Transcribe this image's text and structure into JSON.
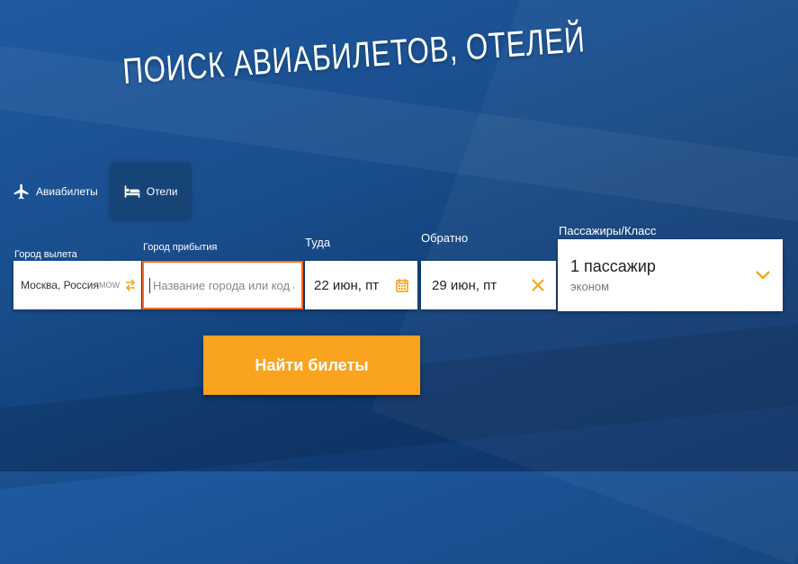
{
  "hero": {
    "title": "ПОИСК АВИАБИЛЕТОВ, ОТЕЛЕЙ"
  },
  "tabs": [
    {
      "label": "Авиабилеты",
      "icon": "airplane-icon",
      "active": false
    },
    {
      "label": "Отели",
      "icon": "bed-icon",
      "active": true
    }
  ],
  "form": {
    "from": {
      "label": "Город вылета",
      "value": "Москва, Россия",
      "code": "MOW"
    },
    "to": {
      "label": "Город прибытия",
      "placeholder": "Название города или код а..."
    },
    "depart": {
      "label": "Туда",
      "value": "22 июн, пт"
    },
    "return": {
      "label": "Обратно",
      "value": "29 июн, пт"
    },
    "passengers": {
      "label": "Пассажиры/Класс",
      "count": "1 пассажир",
      "class": "эконом"
    }
  },
  "submit": {
    "label": "Найти билеты"
  },
  "colors": {
    "accent": "#f9a31f",
    "focus": "#ff6a1f",
    "background": "#1a4f8f"
  }
}
